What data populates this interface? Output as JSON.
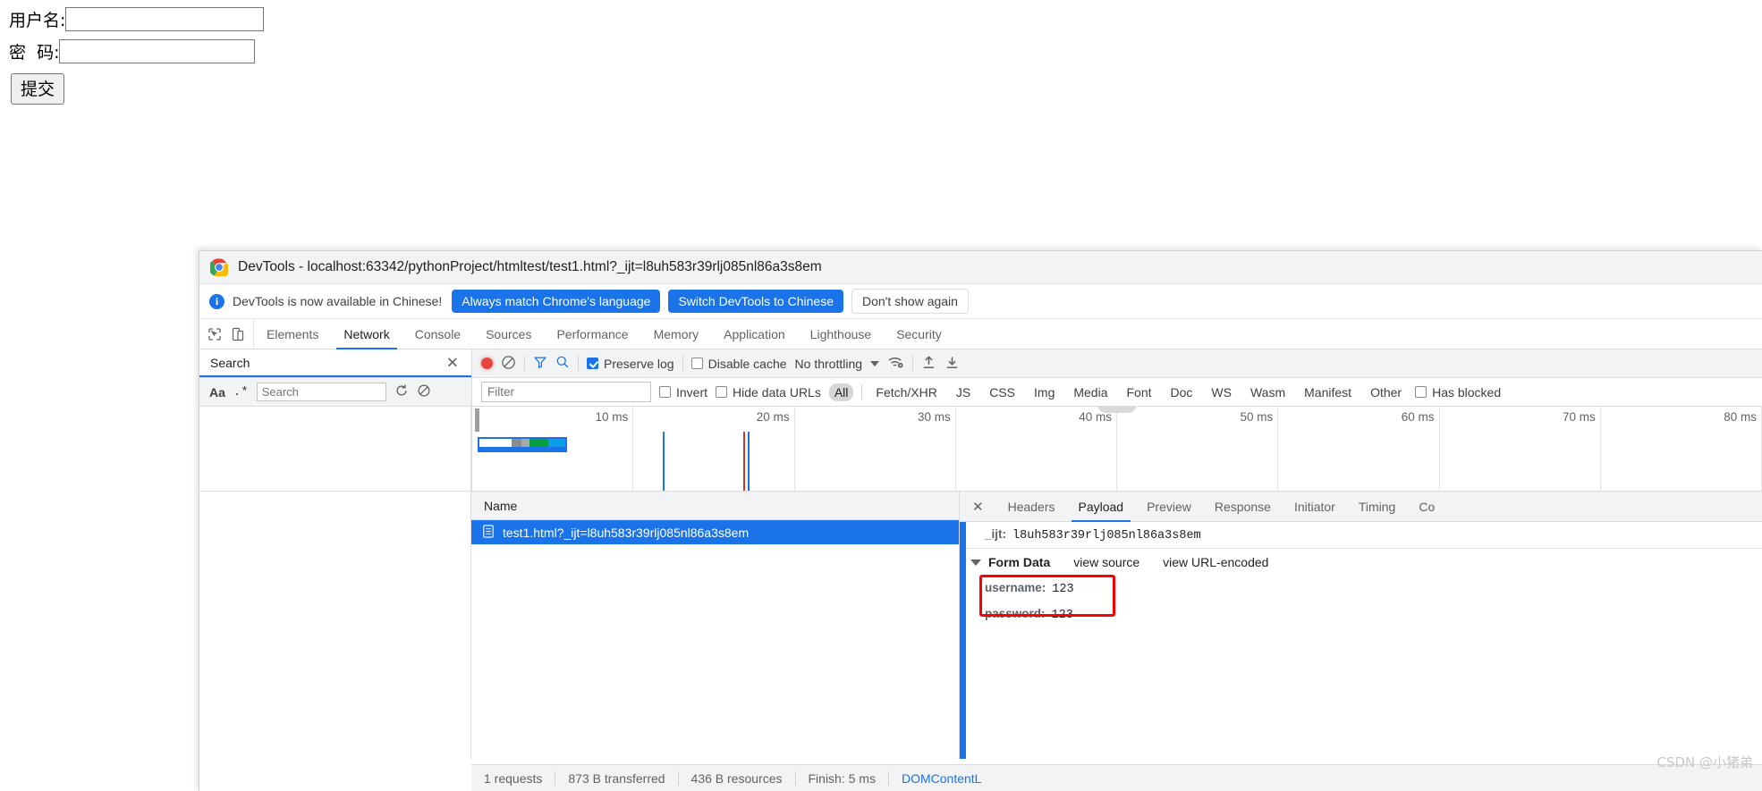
{
  "page_form": {
    "username_label": "用户名:",
    "password_label": "密  码:",
    "username_value": "",
    "password_value": "",
    "submit_label": "提交"
  },
  "devtools": {
    "window_title": "DevTools - localhost:63342/pythonProject/htmltest/test1.html?_ijt=l8uh583r39rlj085nl86a3s8em",
    "notice": {
      "message": "DevTools is now available in Chinese!",
      "primary_button": "Always match Chrome's language",
      "secondary_button": "Switch DevTools to Chinese",
      "dismiss_button": "Don't show again"
    },
    "main_tabs": [
      {
        "label": "Elements",
        "active": false
      },
      {
        "label": "Network",
        "active": true
      },
      {
        "label": "Console",
        "active": false
      },
      {
        "label": "Sources",
        "active": false
      },
      {
        "label": "Performance",
        "active": false
      },
      {
        "label": "Memory",
        "active": false
      },
      {
        "label": "Application",
        "active": false
      },
      {
        "label": "Lighthouse",
        "active": false
      },
      {
        "label": "Security",
        "active": false
      }
    ],
    "search_panel": {
      "title": "Search",
      "close_label": "✕",
      "match_case_label": "Aa",
      "regex_label": ".*",
      "input_placeholder": "Search",
      "input_value": ""
    },
    "network_toolbar": {
      "preserve_log_label": "Preserve log",
      "preserve_log_checked": true,
      "disable_cache_label": "Disable cache",
      "disable_cache_checked": false,
      "throttling_label": "No throttling"
    },
    "filter_bar": {
      "filter_placeholder": "Filter",
      "filter_value": "",
      "invert_label": "Invert",
      "invert_checked": false,
      "hide_data_urls_label": "Hide data URLs",
      "hide_data_urls_checked": false,
      "types": [
        "All",
        "Fetch/XHR",
        "JS",
        "CSS",
        "Img",
        "Media",
        "Font",
        "Doc",
        "WS",
        "Wasm",
        "Manifest",
        "Other"
      ],
      "selected_type": "All",
      "has_blocked_label": "Has blocked",
      "has_blocked_checked": false
    },
    "overview": {
      "ticks": [
        "10 ms",
        "20 ms",
        "30 ms",
        "40 ms",
        "50 ms",
        "60 ms",
        "70 ms",
        "80 ms"
      ]
    },
    "requests_panel": {
      "column_header": "Name",
      "rows": [
        {
          "name": "test1.html?_ijt=l8uh583r39rlj085nl86a3s8em",
          "selected": true
        }
      ]
    },
    "detail_tabs": [
      {
        "label": "Headers",
        "active": false
      },
      {
        "label": "Payload",
        "active": true
      },
      {
        "label": "Preview",
        "active": false
      },
      {
        "label": "Response",
        "active": false
      },
      {
        "label": "Initiator",
        "active": false
      },
      {
        "label": "Timing",
        "active": false
      },
      {
        "label": "Co",
        "active": false
      }
    ],
    "payload": {
      "query_param_key": "_ijt:",
      "query_param_value": "l8uh583r39rlj085nl86a3s8em",
      "form_data_title": "Form Data",
      "view_source_label": "view source",
      "view_url_encoded_label": "view URL-encoded",
      "entries": [
        {
          "key": "username:",
          "value": "123"
        },
        {
          "key": "password:",
          "value": "123"
        }
      ]
    },
    "status_bar": {
      "requests": "1 requests",
      "transferred": "873 B transferred",
      "resources": "436 B resources",
      "finish": "Finish: 5 ms",
      "dom_content": "DOMContentL"
    }
  },
  "watermark": "CSDN @小猪弟",
  "colors": {
    "accent": "#1a73e8",
    "record": "#e8453c",
    "highlight_box": "#ff0000",
    "toolbar_bg": "#f1f3f4"
  }
}
